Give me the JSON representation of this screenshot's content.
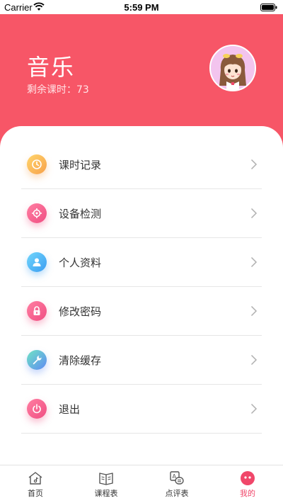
{
  "status_bar": {
    "carrier": "Carrier",
    "time": "5:59 PM"
  },
  "header": {
    "title": "音乐",
    "remaining_label": "剩余课时：73",
    "background_color": "#f75667"
  },
  "menu": {
    "items": [
      {
        "label": "课时记录",
        "icon": "clock-icon"
      },
      {
        "label": "设备检测",
        "icon": "target-icon"
      },
      {
        "label": "个人资料",
        "icon": "user-icon"
      },
      {
        "label": "修改密码",
        "icon": "lock-icon"
      },
      {
        "label": "清除缓存",
        "icon": "wrench-icon"
      },
      {
        "label": "退出",
        "icon": "power-icon"
      }
    ]
  },
  "tab_bar": {
    "active_color": "#f0476a",
    "tabs": [
      {
        "label": "首页",
        "icon": "home-icon",
        "active": false
      },
      {
        "label": "课程表",
        "icon": "book-icon",
        "active": false
      },
      {
        "label": "点评表",
        "icon": "review-icon",
        "active": false
      },
      {
        "label": "我的",
        "icon": "profile-icon",
        "active": true
      }
    ]
  }
}
